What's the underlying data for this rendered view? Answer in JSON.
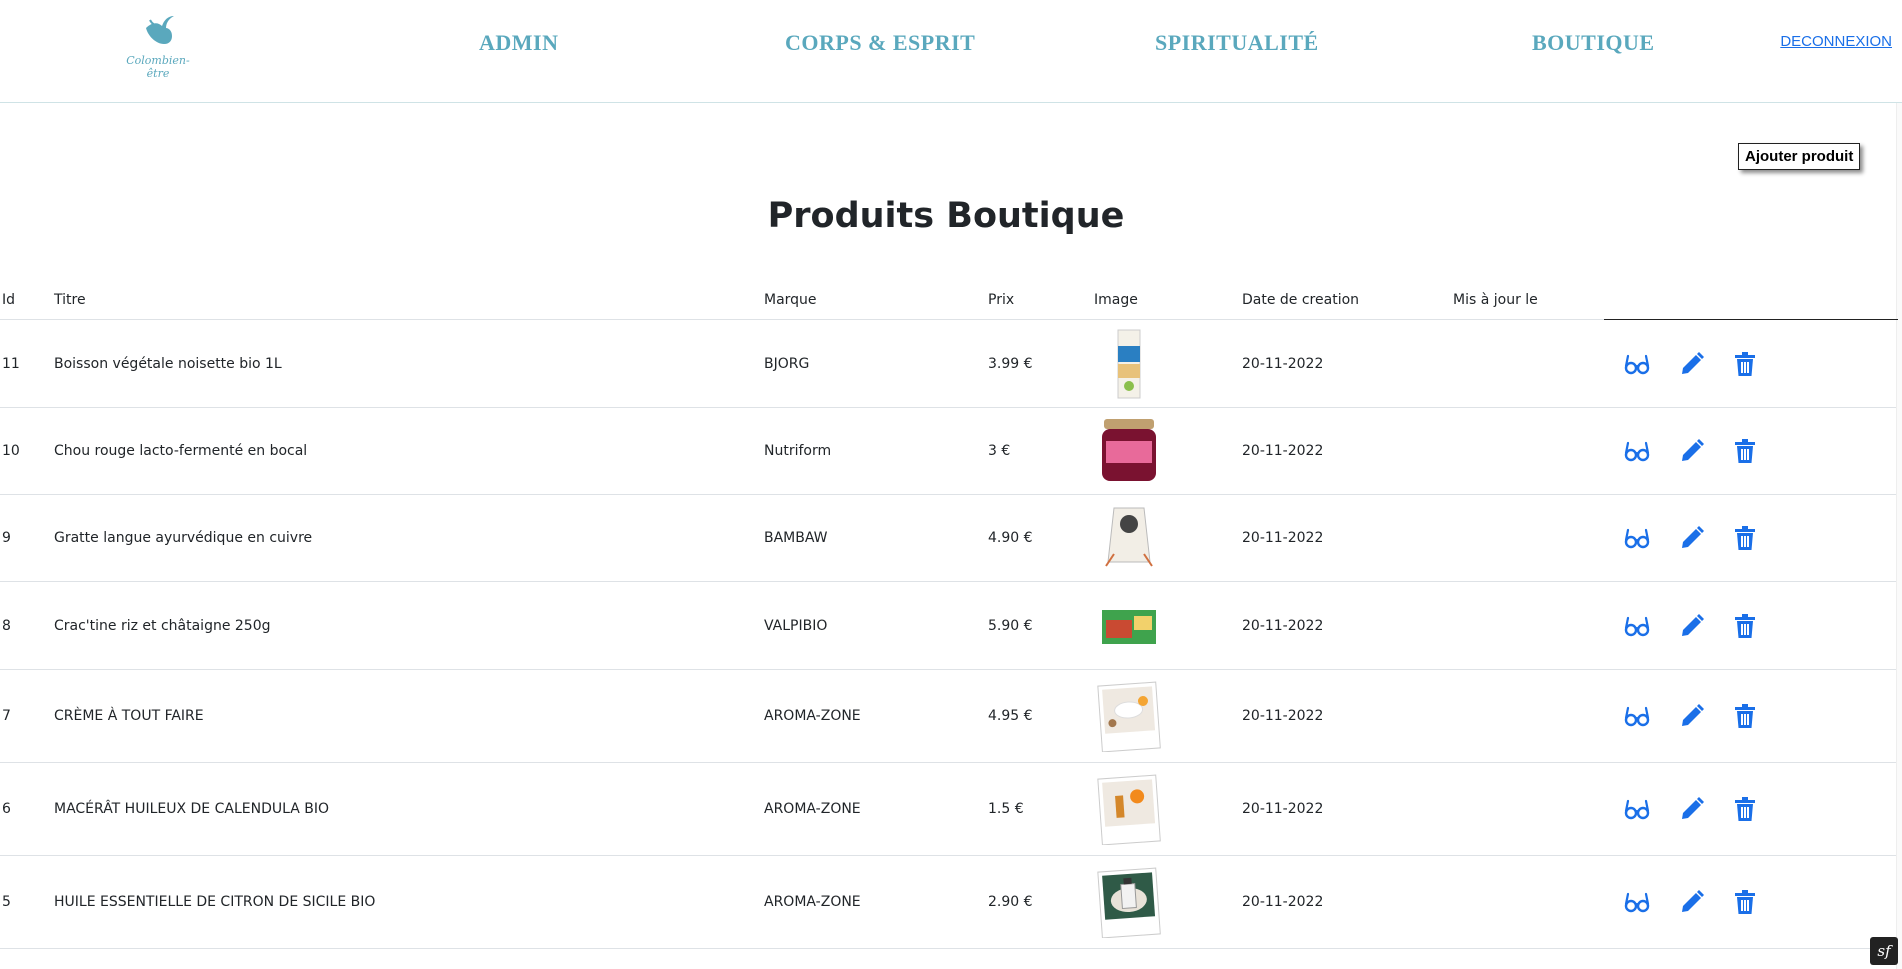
{
  "header": {
    "logo_text": "Colombien-être",
    "nav": [
      {
        "label": "ADMIN"
      },
      {
        "label": "CORPS & ESPRIT"
      },
      {
        "label": "SPIRITUALITÉ"
      },
      {
        "label": "BOUTIQUE"
      }
    ],
    "logout_label": "DECONNEXION"
  },
  "add_button_label": "Ajouter produit",
  "page_title": "Produits Boutique",
  "table": {
    "headers": {
      "id": "Id",
      "title": "Titre",
      "brand": "Marque",
      "price": "Prix",
      "image": "Image",
      "created": "Date de creation",
      "updated": "Mis à jour le"
    },
    "rows": [
      {
        "id": "11",
        "title": "Boisson végétale noisette bio 1L",
        "brand": "BJORG",
        "price": "3.99 €",
        "created": "20-11-2022",
        "updated": "",
        "image": "milk-carton"
      },
      {
        "id": "10",
        "title": "Chou rouge lacto-fermenté en bocal",
        "brand": "Nutriform",
        "price": "3 €",
        "created": "20-11-2022",
        "updated": "",
        "image": "jar"
      },
      {
        "id": "9",
        "title": "Gratte langue ayurvédique en cuivre",
        "brand": "BAMBAW",
        "price": "4.90 €",
        "created": "20-11-2022",
        "updated": "",
        "image": "pouch"
      },
      {
        "id": "8",
        "title": "Crac'tine riz et châtaigne 250g",
        "brand": "VALPIBIO",
        "price": "5.90 €",
        "created": "20-11-2022",
        "updated": "",
        "image": "box"
      },
      {
        "id": "7",
        "title": "CRÈME À TOUT FAIRE",
        "brand": "AROMA-ZONE",
        "price": "4.95 €",
        "created": "20-11-2022",
        "updated": "",
        "image": "polaroid-cream"
      },
      {
        "id": "6",
        "title": "MACÉRÂT HUILEUX DE CALENDULA BIO",
        "brand": "AROMA-ZONE",
        "price": "1.5 €",
        "created": "20-11-2022",
        "updated": "",
        "image": "polaroid-calendula"
      },
      {
        "id": "5",
        "title": "HUILE ESSENTIELLE DE CITRON DE SICILE BIO",
        "brand": "AROMA-ZONE",
        "price": "2.90 €",
        "created": "20-11-2022",
        "updated": "",
        "image": "polaroid-bottle"
      }
    ]
  },
  "colors": {
    "nav": "#5aa8bd",
    "action_icons": "#1a6fe8",
    "link": "#1a6fe8"
  },
  "icons": {
    "view": "glasses-icon",
    "edit": "pencil-icon",
    "delete": "trash-icon"
  }
}
